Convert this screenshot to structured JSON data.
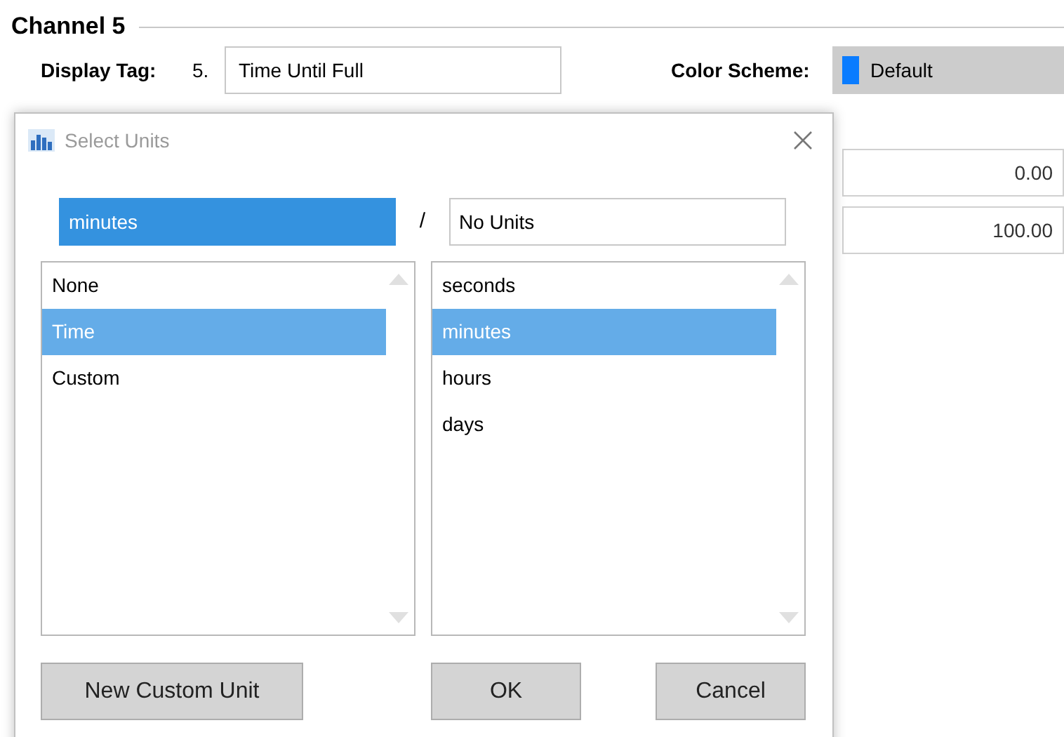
{
  "section": {
    "title": "Channel 5"
  },
  "display_tag": {
    "label": "Display Tag:",
    "prefix": "5.",
    "value": "Time Until Full"
  },
  "color_scheme": {
    "label": "Color Scheme:",
    "value": "Default"
  },
  "range_fields": [
    "0.00",
    "100.00"
  ],
  "dialog": {
    "title": "Select Units",
    "numerator": {
      "value": "minutes",
      "selected": true
    },
    "separator": "/",
    "denominator": {
      "value": "No Units",
      "selected": false
    },
    "categories": [
      {
        "label": "None",
        "selected": false
      },
      {
        "label": "Time",
        "selected": true
      },
      {
        "label": "Custom",
        "selected": false
      }
    ],
    "units": [
      {
        "label": "seconds",
        "selected": false
      },
      {
        "label": "minutes",
        "selected": true
      },
      {
        "label": "hours",
        "selected": false
      },
      {
        "label": "days",
        "selected": false
      }
    ],
    "buttons": {
      "new_custom": "New Custom Unit",
      "ok": "OK",
      "cancel": "Cancel"
    }
  }
}
